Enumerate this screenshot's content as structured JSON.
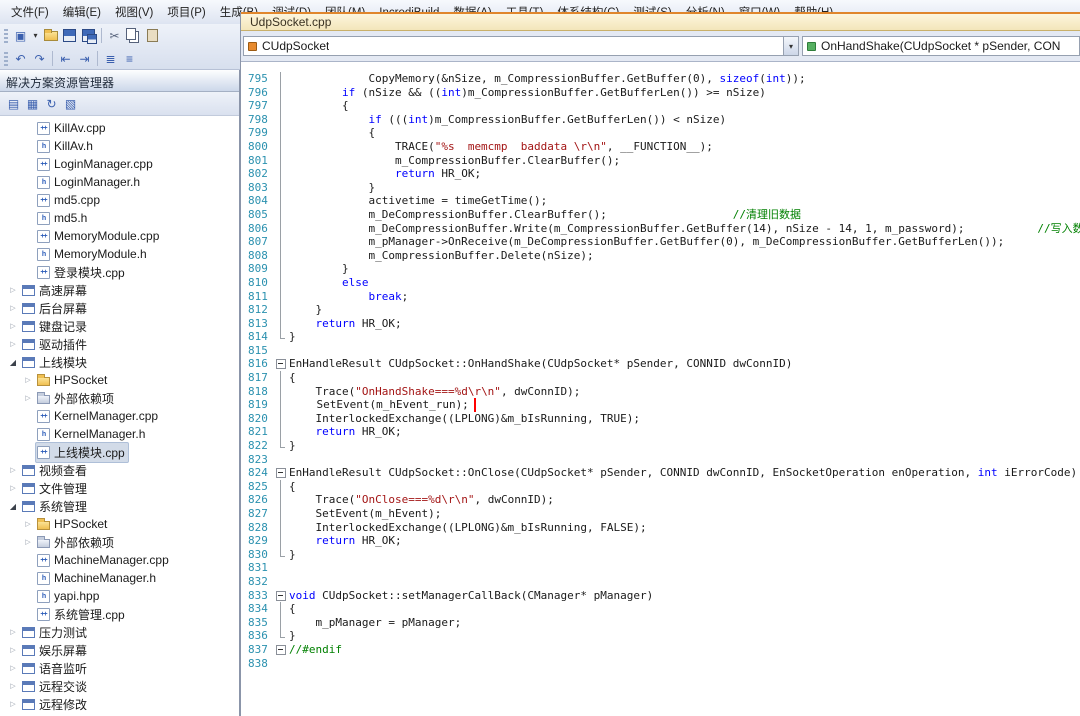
{
  "icons": {
    "dropdown_arrow": "▾",
    "tree_collapsed": "▷",
    "tree_expanded": "◢",
    "cpp_badge": "++",
    "h_badge": "h"
  },
  "colors": {
    "line_number": "#2b91af",
    "keyword": "#0000ff",
    "string": "#a31515",
    "comment": "#008000",
    "highlight_box": "#ff0000",
    "active_tab_accent": "#e0862c"
  },
  "menu": {
    "items": [
      "文件(F)",
      "编辑(E)",
      "视图(V)",
      "项目(P)",
      "生成(B)",
      "调试(D)",
      "团队(M)",
      "IncrediBuild",
      "数据(A)",
      "工具(T)",
      "体系结构(C)",
      "测试(S)",
      "分析(N)",
      "窗口(W)",
      "帮助(H)"
    ]
  },
  "toolbar": {
    "rows": [
      [
        {
          "name": "new-project-icon",
          "glyph": "▣"
        },
        {
          "name": "toolbar-dropdown-icon",
          "glyph": "▾",
          "cls": "dd"
        },
        {
          "name": "open-file-icon",
          "cls": "folder-tb"
        },
        {
          "name": "save-icon",
          "cls": "floppy"
        },
        {
          "name": "save-all-icon",
          "cls": "floppy multi"
        },
        {
          "sep": true
        },
        {
          "name": "cut-icon",
          "glyph": "✂",
          "cls": "dark"
        },
        {
          "name": "copy-icon",
          "cls": "copy-tb"
        },
        {
          "name": "paste-icon",
          "cls": "paste-tb"
        }
      ],
      [
        {
          "name": "navigate-backward-icon",
          "glyph": "↶"
        },
        {
          "name": "navigate-forward-icon",
          "glyph": "↷"
        },
        {
          "sep": true
        },
        {
          "name": "outdent-icon",
          "glyph": "⇤"
        },
        {
          "name": "indent-icon",
          "glyph": "⇥"
        },
        {
          "sep": true
        },
        {
          "name": "comment-lines-icon",
          "glyph": "≣"
        },
        {
          "name": "uncomment-lines-icon",
          "glyph": "≡"
        }
      ]
    ]
  },
  "document_tab": {
    "title": "UdpSocket.cpp"
  },
  "navigation_bar": {
    "type_dropdown": "CUdpSocket",
    "member_dropdown": "OnHandShake(CUdpSocket * pSender, CON"
  },
  "solution_explorer": {
    "title": "解决方案资源管理器",
    "toolbar": [
      {
        "name": "properties-icon",
        "glyph": "▤"
      },
      {
        "name": "show-all-files-icon",
        "glyph": "▦"
      },
      {
        "name": "refresh-icon",
        "glyph": "↻"
      },
      {
        "name": "class-diagram-icon",
        "glyph": "▧"
      }
    ],
    "items": [
      {
        "label": "KillAv.cpp",
        "kind": "cpp",
        "indent": 1
      },
      {
        "label": "KillAv.h",
        "kind": "h",
        "indent": 1
      },
      {
        "label": "LoginManager.cpp",
        "kind": "cpp",
        "indent": 1
      },
      {
        "label": "LoginManager.h",
        "kind": "h",
        "indent": 1
      },
      {
        "label": "md5.cpp",
        "kind": "cpp",
        "indent": 1
      },
      {
        "label": "md5.h",
        "kind": "h",
        "indent": 1
      },
      {
        "label": "MemoryModule.cpp",
        "kind": "cpp",
        "indent": 1
      },
      {
        "label": "MemoryModule.h",
        "kind": "h",
        "indent": 1
      },
      {
        "label": "登录模块.cpp",
        "kind": "cpp",
        "indent": 1
      },
      {
        "label": "高速屏幕",
        "kind": "project",
        "indent": 0,
        "arrow": "right"
      },
      {
        "label": "后台屏幕",
        "kind": "project",
        "indent": 0,
        "arrow": "right"
      },
      {
        "label": "键盘记录",
        "kind": "project",
        "indent": 0,
        "arrow": "right"
      },
      {
        "label": "驱动插件",
        "kind": "project",
        "indent": 0,
        "arrow": "right"
      },
      {
        "label": "上线模块",
        "kind": "project",
        "indent": 0,
        "arrow": "down"
      },
      {
        "label": "HPSocket",
        "kind": "folder",
        "indent": 1,
        "arrow": "right"
      },
      {
        "label": "外部依赖项",
        "kind": "external",
        "indent": 1,
        "arrow": "right"
      },
      {
        "label": "KernelManager.cpp",
        "kind": "cpp",
        "indent": 1
      },
      {
        "label": "KernelManager.h",
        "kind": "h",
        "indent": 1
      },
      {
        "label": "上线模块.cpp",
        "kind": "cpp",
        "indent": 1,
        "selected": true
      },
      {
        "label": "视频查看",
        "kind": "project",
        "indent": 0,
        "arrow": "right"
      },
      {
        "label": "文件管理",
        "kind": "project",
        "indent": 0,
        "arrow": "right"
      },
      {
        "label": "系统管理",
        "kind": "project",
        "indent": 0,
        "arrow": "down"
      },
      {
        "label": "HPSocket",
        "kind": "folder",
        "indent": 1,
        "arrow": "right"
      },
      {
        "label": "外部依赖项",
        "kind": "external",
        "indent": 1,
        "arrow": "right"
      },
      {
        "label": "MachineManager.cpp",
        "kind": "cpp",
        "indent": 1
      },
      {
        "label": "MachineManager.h",
        "kind": "h",
        "indent": 1
      },
      {
        "label": "yapi.hpp",
        "kind": "hpp",
        "indent": 1
      },
      {
        "label": "系统管理.cpp",
        "kind": "cpp",
        "indent": 1
      },
      {
        "label": "压力测试",
        "kind": "project",
        "indent": 0,
        "arrow": "right"
      },
      {
        "label": "娱乐屏幕",
        "kind": "project",
        "indent": 0,
        "arrow": "right"
      },
      {
        "label": "语音监听",
        "kind": "project",
        "indent": 0,
        "arrow": "right"
      },
      {
        "label": "远程交谈",
        "kind": "project",
        "indent": 0,
        "arrow": "right"
      },
      {
        "label": "远程修改",
        "kind": "project",
        "indent": 0,
        "arrow": "right"
      }
    ]
  },
  "editor": {
    "lines": [
      {
        "n": 795,
        "o": "l",
        "s": [
          [
            "p",
            "            CopyMemory(&nSize, m_CompressionBuffer.GetBuffer(0), "
          ],
          [
            "k",
            "sizeof"
          ],
          [
            "p",
            "("
          ],
          [
            "k",
            "int"
          ],
          [
            "p",
            "));"
          ]
        ]
      },
      {
        "n": 796,
        "o": "l",
        "s": [
          [
            "p",
            "        "
          ],
          [
            "k",
            "if"
          ],
          [
            "p",
            " (nSize && (("
          ],
          [
            "k",
            "int"
          ],
          [
            "p",
            ")m_CompressionBuffer.GetBufferLen()) >= nSize)"
          ]
        ]
      },
      {
        "n": 797,
        "o": "l",
        "s": [
          [
            "p",
            "        {"
          ]
        ]
      },
      {
        "n": 798,
        "o": "l",
        "s": [
          [
            "p",
            "            "
          ],
          [
            "k",
            "if"
          ],
          [
            "p",
            " ((("
          ],
          [
            "k",
            "int"
          ],
          [
            "p",
            ")m_CompressionBuffer.GetBufferLen()) < nSize)"
          ]
        ]
      },
      {
        "n": 799,
        "o": "l",
        "s": [
          [
            "p",
            "            {"
          ]
        ]
      },
      {
        "n": 800,
        "o": "l",
        "s": [
          [
            "p",
            "                TRACE("
          ],
          [
            "s",
            "\"%s  memcmp  baddata \\r\\n\""
          ],
          [
            "p",
            ", __FUNCTION__);"
          ]
        ]
      },
      {
        "n": 801,
        "o": "l",
        "s": [
          [
            "p",
            "                m_CompressionBuffer.ClearBuffer();"
          ]
        ]
      },
      {
        "n": 802,
        "o": "l",
        "s": [
          [
            "p",
            "                "
          ],
          [
            "k",
            "return"
          ],
          [
            "p",
            " HR_OK;"
          ]
        ]
      },
      {
        "n": 803,
        "o": "l",
        "s": [
          [
            "p",
            "            }"
          ]
        ]
      },
      {
        "n": 804,
        "o": "l",
        "s": [
          [
            "p",
            "            activetime = timeGetTime();"
          ]
        ]
      },
      {
        "n": 805,
        "o": "l",
        "s": [
          [
            "p",
            "            m_DeCompressionBuffer.ClearBuffer();                   "
          ],
          [
            "c",
            "//清理旧数据"
          ]
        ]
      },
      {
        "n": 806,
        "o": "l",
        "s": [
          [
            "p",
            "            m_DeCompressionBuffer.Write(m_CompressionBuffer.GetBuffer(14), nSize - 14, 1, m_password);           "
          ],
          [
            "c",
            "//写入数"
          ]
        ]
      },
      {
        "n": 807,
        "o": "l",
        "s": [
          [
            "p",
            "            m_pManager->OnReceive(m_DeCompressionBuffer.GetBuffer(0), m_DeCompressionBuffer.GetBufferLen());"
          ]
        ]
      },
      {
        "n": 808,
        "o": "l",
        "s": [
          [
            "p",
            "            m_CompressionBuffer.Delete(nSize);"
          ]
        ]
      },
      {
        "n": 809,
        "o": "l",
        "s": [
          [
            "p",
            "        }"
          ]
        ]
      },
      {
        "n": 810,
        "o": "l",
        "s": [
          [
            "p",
            "        "
          ],
          [
            "k",
            "else"
          ]
        ]
      },
      {
        "n": 811,
        "o": "l",
        "s": [
          [
            "p",
            "            "
          ],
          [
            "k",
            "break"
          ],
          [
            "p",
            ";"
          ]
        ]
      },
      {
        "n": 812,
        "o": "l",
        "s": [
          [
            "p",
            "    }"
          ]
        ]
      },
      {
        "n": 813,
        "o": "l",
        "s": [
          [
            "p",
            "    "
          ],
          [
            "k",
            "return"
          ],
          [
            "p",
            " HR_OK;"
          ]
        ]
      },
      {
        "n": 814,
        "o": "e",
        "s": [
          [
            "p",
            "}"
          ]
        ]
      },
      {
        "n": 815,
        "o": "",
        "s": []
      },
      {
        "n": 816,
        "o": "m",
        "s": [
          [
            "p",
            "EnHandleResult CUdpSocket::OnHandShake(CUdpSocket* pSender, CONNID dwConnID)"
          ]
        ]
      },
      {
        "n": 817,
        "o": "l",
        "s": [
          [
            "p",
            "{"
          ]
        ]
      },
      {
        "n": 818,
        "o": "l",
        "s": [
          [
            "p",
            "    Trace("
          ],
          [
            "s",
            "\"OnHandShake===%d\\r\\n\""
          ],
          [
            "p",
            ", dwConnID);"
          ]
        ]
      },
      {
        "n": 819,
        "o": "l",
        "b": true,
        "s": [
          [
            "p",
            "    SetEvent(m_hEvent_run);"
          ]
        ]
      },
      {
        "n": 820,
        "o": "l",
        "s": [
          [
            "p",
            "    InterlockedExchange((LPLONG)&m_bIsRunning, TRUE);"
          ]
        ]
      },
      {
        "n": 821,
        "o": "l",
        "s": [
          [
            "p",
            "    "
          ],
          [
            "k",
            "return"
          ],
          [
            "p",
            " HR_OK;"
          ]
        ]
      },
      {
        "n": 822,
        "o": "e",
        "s": [
          [
            "p",
            "}"
          ]
        ]
      },
      {
        "n": 823,
        "o": "",
        "s": []
      },
      {
        "n": 824,
        "o": "m",
        "s": [
          [
            "p",
            "EnHandleResult CUdpSocket::OnClose(CUdpSocket* pSender, CONNID dwConnID, EnSocketOperation enOperation, "
          ],
          [
            "k",
            "int"
          ],
          [
            "p",
            " iErrorCode)"
          ]
        ]
      },
      {
        "n": 825,
        "o": "l",
        "s": [
          [
            "p",
            "{"
          ]
        ]
      },
      {
        "n": 826,
        "o": "l",
        "s": [
          [
            "p",
            "    Trace("
          ],
          [
            "s",
            "\"OnClose===%d\\r\\n\""
          ],
          [
            "p",
            ", dwConnID);"
          ]
        ]
      },
      {
        "n": 827,
        "o": "l",
        "s": [
          [
            "p",
            "    SetEvent(m_hEvent);"
          ]
        ]
      },
      {
        "n": 828,
        "o": "l",
        "s": [
          [
            "p",
            "    InterlockedExchange((LPLONG)&m_bIsRunning, FALSE);"
          ]
        ]
      },
      {
        "n": 829,
        "o": "l",
        "s": [
          [
            "p",
            "    "
          ],
          [
            "k",
            "return"
          ],
          [
            "p",
            " HR_OK;"
          ]
        ]
      },
      {
        "n": 830,
        "o": "e",
        "s": [
          [
            "p",
            "}"
          ]
        ]
      },
      {
        "n": 831,
        "o": "",
        "s": []
      },
      {
        "n": 832,
        "o": "",
        "s": []
      },
      {
        "n": 833,
        "o": "m",
        "s": [
          [
            "k",
            "void"
          ],
          [
            "p",
            " CUdpSocket::setManagerCallBack(CManager* pManager)"
          ]
        ]
      },
      {
        "n": 834,
        "o": "l",
        "s": [
          [
            "p",
            "{"
          ]
        ]
      },
      {
        "n": 835,
        "o": "l",
        "s": [
          [
            "p",
            "    m_pManager = pManager;"
          ]
        ]
      },
      {
        "n": 836,
        "o": "e",
        "s": [
          [
            "p",
            "}"
          ]
        ]
      },
      {
        "n": 837,
        "o": "m",
        "s": [
          [
            "c",
            "//#endif"
          ]
        ]
      },
      {
        "n": 838,
        "o": "",
        "s": []
      }
    ]
  }
}
